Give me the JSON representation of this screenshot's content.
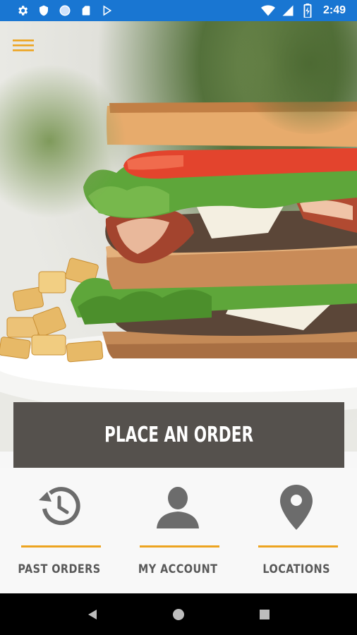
{
  "status_bar": {
    "time": "2:49",
    "left_icons": [
      "settings-icon",
      "shield-icon",
      "circle-icon",
      "sd-card-icon",
      "play-store-icon"
    ],
    "right_icons": [
      "wifi-icon",
      "signal-icon",
      "battery-icon"
    ],
    "background": "#1976d2"
  },
  "header": {
    "menu_icon": "hamburger-menu-icon",
    "accent": "#eda420"
  },
  "hero": {
    "image": "sandwich-photo"
  },
  "order_button": {
    "label": "PLACE AN ORDER",
    "background": "#55514d"
  },
  "nav_tiles": [
    {
      "label": "PAST ORDERS",
      "icon": "history-icon"
    },
    {
      "label": "MY ACCOUNT",
      "icon": "person-icon"
    },
    {
      "label": "LOCATIONS",
      "icon": "location-pin-icon"
    }
  ],
  "system_nav": {
    "keys": [
      "back-icon",
      "home-icon",
      "recents-icon"
    ]
  }
}
